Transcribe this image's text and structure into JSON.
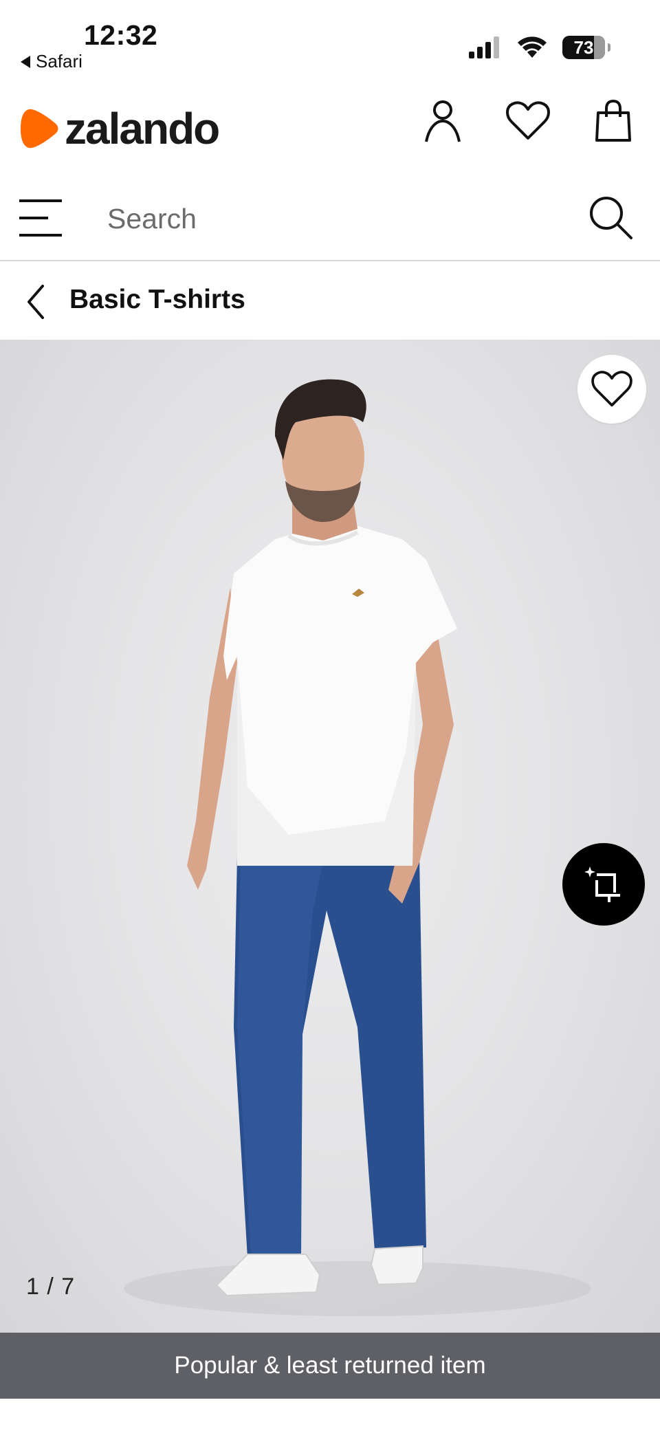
{
  "status_bar": {
    "time": "12:32",
    "back_app": "Safari",
    "battery": "73"
  },
  "header": {
    "logo_text": "zalando",
    "brand_color": "#ff6900",
    "icons": [
      "user-icon",
      "heart-icon",
      "bag-icon"
    ]
  },
  "search": {
    "placeholder": "Search"
  },
  "category": {
    "title": "Basic T-shirts"
  },
  "gallery": {
    "current": "1",
    "total": "7",
    "counter_separator": "/",
    "image_alt": "Man wearing white t-shirt and blue jeans"
  },
  "banner": {
    "text": "Popular & least returned item"
  }
}
